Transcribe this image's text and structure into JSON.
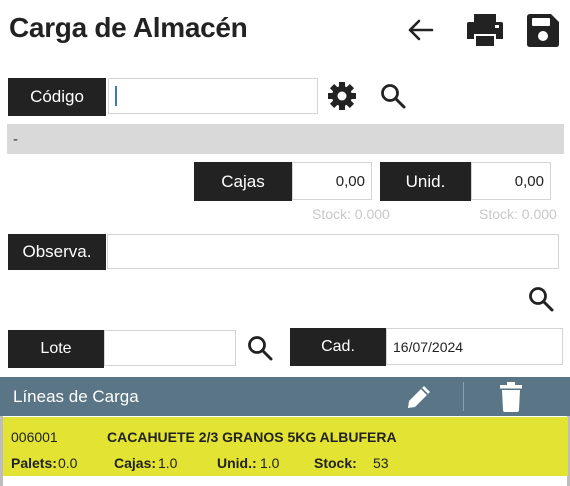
{
  "header": {
    "title": "Carga de Almacén"
  },
  "icons": {
    "back": "arrow-left-icon",
    "print": "printer-icon",
    "save": "floppy-disk-icon",
    "settings": "gear-icon",
    "search": "search-icon",
    "edit": "pencil-icon",
    "delete": "trash-icon"
  },
  "codigo": {
    "label": "Código",
    "value": ""
  },
  "description": "-",
  "cajas": {
    "label": "Cajas",
    "value": "0,00",
    "stock": "Stock: 0.000"
  },
  "unid": {
    "label": "Unid.",
    "value": "0,00",
    "stock": "Stock: 0.000"
  },
  "observa": {
    "label": "Observa.",
    "value": ""
  },
  "lote": {
    "label": "Lote",
    "value": ""
  },
  "cad": {
    "label": "Cad.",
    "value": "16/07/2024"
  },
  "lines": {
    "title": "Líneas de Carga",
    "items": [
      {
        "code": "006001",
        "name": "CACAHUETE 2/3 GRANOS 5KG ALBUFERA",
        "palets_label": "Palets:",
        "palets": "0.0",
        "cajas_label": "Cajas:",
        "cajas": "1.0",
        "unid_label": "Unid.:",
        "unid": "1.0",
        "stock_label": "Stock:",
        "stock": "53"
      }
    ]
  },
  "colors": {
    "dark_label": "#222222",
    "header_bar": "#5a7585",
    "selected_row": "#e3e334",
    "gray_bar": "#d9d9d9"
  }
}
